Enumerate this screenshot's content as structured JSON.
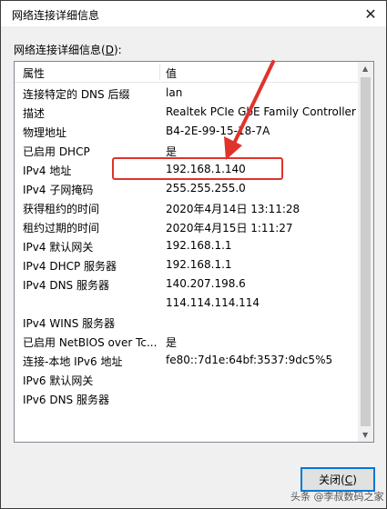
{
  "window": {
    "title": "网络连接详细信息",
    "close_glyph": "✕"
  },
  "group": {
    "label_prefix": "网络连接详细信息(",
    "label_access": "D",
    "label_suffix": "):"
  },
  "table": {
    "col_property": "属性",
    "col_value": "值",
    "rows": [
      {
        "k": "连接特定的 DNS 后缀",
        "v": "lan"
      },
      {
        "k": "描述",
        "v": "Realtek PCIe GbE Family Controller"
      },
      {
        "k": "物理地址",
        "v": "B4-2E-99-15-18-7A"
      },
      {
        "k": "已启用 DHCP",
        "v": "是"
      },
      {
        "k": "IPv4 地址",
        "v": "192.168.1.140"
      },
      {
        "k": "IPv4 子网掩码",
        "v": "255.255.255.0"
      },
      {
        "k": "获得租约的时间",
        "v": "2020年4月14日 13:11:28"
      },
      {
        "k": "租约过期的时间",
        "v": "2020年4月15日 1:11:27"
      },
      {
        "k": "IPv4 默认网关",
        "v": "192.168.1.1"
      },
      {
        "k": "IPv4 DHCP 服务器",
        "v": "192.168.1.1"
      },
      {
        "k": "IPv4 DNS 服务器",
        "v": "140.207.198.6"
      },
      {
        "k": "",
        "v": "114.114.114.114"
      },
      {
        "k": "IPv4 WINS 服务器",
        "v": ""
      },
      {
        "k": "已启用 NetBIOS over Tc...",
        "v": "是"
      },
      {
        "k": "连接-本地 IPv6 地址",
        "v": "fe80::7d1e:64bf:3537:9dc5%5"
      },
      {
        "k": "IPv6 默认网关",
        "v": ""
      },
      {
        "k": "IPv6 DNS 服务器",
        "v": ""
      }
    ]
  },
  "buttons": {
    "close_prefix": "关闭(",
    "close_access": "C",
    "close_suffix": ")"
  },
  "watermark": "头条 @李叔数码之家",
  "colors": {
    "annotation_red": "#e0332b",
    "focus_blue": "#0078d7"
  }
}
